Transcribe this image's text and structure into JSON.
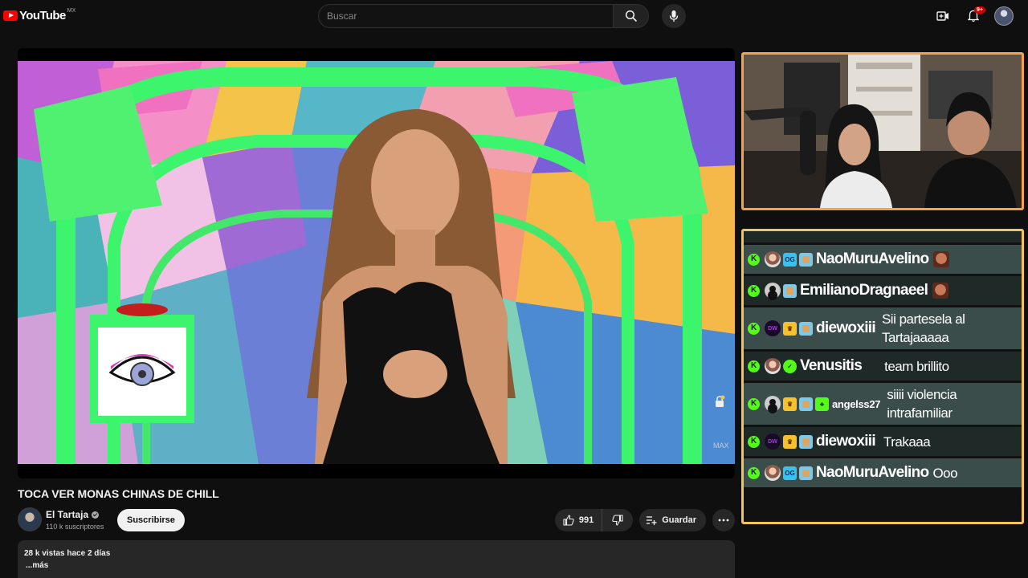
{
  "header": {
    "logo_text": "YouTube",
    "logo_country": "MX",
    "search_placeholder": "Buscar",
    "notification_count": "9+"
  },
  "video": {
    "title": "TOCA VER MONAS CHINAS DE CHILL",
    "watermark": "MAX"
  },
  "channel": {
    "name": "El Tartaja",
    "subscribers": "110 k suscriptores",
    "subscribe_label": "Suscribirse"
  },
  "actions": {
    "like_count": "991",
    "save_label": "Guardar"
  },
  "description": {
    "stats": "28 k vistas  hace 2 días",
    "more": "...más"
  },
  "chat": {
    "messages": [
      {
        "user": "NaoMuruAvelino",
        "text": ""
      },
      {
        "user": "EmilianoDragnaeel",
        "text": ""
      },
      {
        "user": "diewoxiii",
        "text": "Sii partesela al Tartajaaaaa"
      },
      {
        "user": "Venusitis",
        "text": "team brillito"
      },
      {
        "user": "angelss27",
        "text": "siiii violencia intrafamiliar"
      },
      {
        "user": "diewoxiii",
        "text": "Trakaaa"
      },
      {
        "user": "NaoMuruAvelino",
        "text": "Ooo"
      }
    ]
  },
  "colors": {
    "cam_border": "#f6a14b",
    "chat_border": "#f2c45a",
    "kick_green": "#53fc18",
    "youtube_red": "#ff0000"
  }
}
